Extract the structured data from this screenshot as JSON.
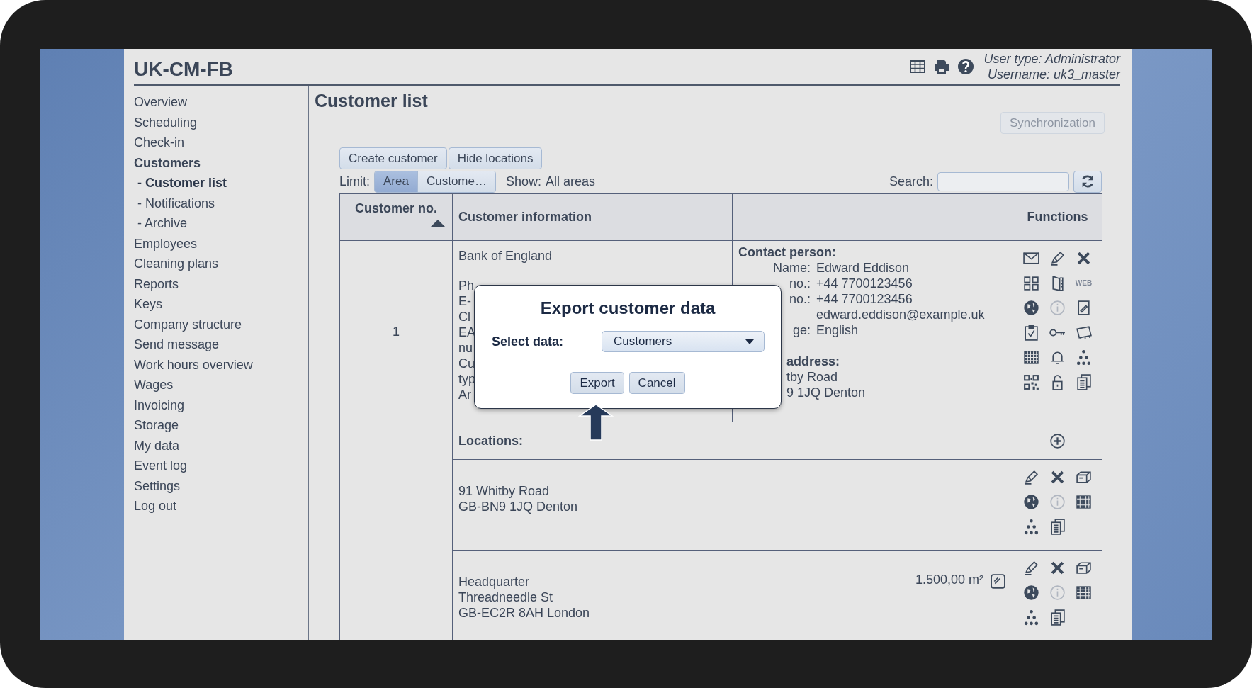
{
  "app": {
    "title": "UK-CM-FB",
    "user_type": "User type: Administrator",
    "username": "Username: uk3_master"
  },
  "sidebar": {
    "items": [
      {
        "label": "Overview",
        "selected": false
      },
      {
        "label": "Scheduling",
        "selected": false
      },
      {
        "label": "Check-in",
        "selected": false
      },
      {
        "label": "Customers",
        "selected": false,
        "expanded": true,
        "children": [
          {
            "label": "- Customer list",
            "selected": true
          },
          {
            "label": "- Notifications",
            "selected": false
          },
          {
            "label": "- Archive",
            "selected": false
          }
        ]
      },
      {
        "label": "Employees",
        "selected": false
      },
      {
        "label": "Cleaning plans",
        "selected": false
      },
      {
        "label": "Reports",
        "selected": false
      },
      {
        "label": "Keys",
        "selected": false
      },
      {
        "label": "Company structure",
        "selected": false
      },
      {
        "label": "Send message",
        "selected": false
      },
      {
        "label": "Work hours overview",
        "selected": false
      },
      {
        "label": "Wages",
        "selected": false
      },
      {
        "label": "Invoicing",
        "selected": false
      },
      {
        "label": "Storage",
        "selected": false
      },
      {
        "label": "My data",
        "selected": false
      },
      {
        "label": "Event log",
        "selected": false
      },
      {
        "label": "Settings",
        "selected": false
      },
      {
        "label": "Log out",
        "selected": false
      }
    ]
  },
  "page": {
    "title": "Customer list",
    "sync_button": {
      "label": "Synchronization",
      "disabled": true
    },
    "actions": [
      "Create customer",
      "Hide locations"
    ],
    "limit": {
      "label": "Limit:",
      "options": [
        {
          "label": "Area",
          "selected": true
        },
        {
          "label": "Custome…",
          "selected": false
        }
      ]
    },
    "show": {
      "label": "Show:",
      "value": "All areas"
    },
    "search": {
      "label": "Search:"
    }
  },
  "table": {
    "columns": [
      "Customer no.",
      "Customer information",
      "Functions"
    ],
    "customer": {
      "number": "1",
      "name": "Bank of England",
      "info_lines": [
        {
          "label": "Ph"
        },
        {
          "label": "E-"
        },
        {
          "label": "Cl"
        },
        {
          "label": "EA"
        },
        {
          "label": "nu"
        },
        {
          "label": "Cu"
        },
        {
          "label": "typ"
        },
        {
          "label": "Ar"
        }
      ],
      "contact_title": "Contact person:",
      "contact_rows": [
        {
          "label": "Name:",
          "value": "Edward Eddison"
        },
        {
          "label": "no.:",
          "value": "+44 7700123456"
        },
        {
          "label": "no.:",
          "value": "+44 7700123456"
        },
        {
          "value": "edward.eddison@example.uk"
        },
        {
          "label": "ge:",
          "value": "English"
        }
      ],
      "address_title": "address:",
      "address_lines": [
        "tby Road",
        "9 1JQ Denton"
      ],
      "web_badge": "WEB"
    },
    "locations_title": "Locations:",
    "locations": [
      {
        "lines": [
          "91 Whitby Road",
          "GB-BN9 1JQ Denton"
        ]
      },
      {
        "lines": [
          "Headquarter",
          "Threadneedle St",
          "GB-EC2R 8AH London"
        ],
        "area": "1.500,00 m²"
      }
    ]
  },
  "dialog": {
    "title": "Export customer data",
    "field_label": "Select data:",
    "value": "Customers",
    "buttons": [
      "Export",
      "Cancel"
    ]
  }
}
